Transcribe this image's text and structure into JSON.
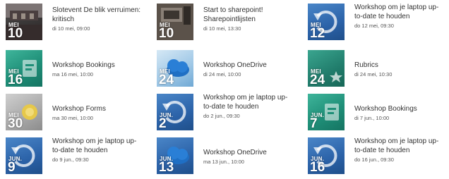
{
  "events": [
    {
      "title": "Slotevent De blik verruimen: kritisch",
      "date": "di 10 mei, 09:00",
      "month": "MEI",
      "day": "10",
      "style": "photo-dark",
      "art": "building-photo",
      "lines": "twoline"
    },
    {
      "title": "Start to sharepoint! Sharepointlijsten",
      "date": "di 10 mei, 13:30",
      "month": "MEI",
      "day": "10",
      "style": "photo-room",
      "art": "room-photo",
      "lines": "twoline"
    },
    {
      "title": "Workshop om je laptop up-to-date te houden",
      "date": "do 12 mei, 09:30",
      "month": "MEI",
      "day": "12",
      "style": "photo-blue",
      "art": "refresh-icon",
      "lines": "threeline"
    },
    {
      "title": "Workshop Bookings",
      "date": "ma 16 mei, 10:00",
      "month": "MEI",
      "day": "16",
      "style": "photo-green",
      "art": "bookings-icon",
      "lines": "oneline"
    },
    {
      "title": "Workshop OneDrive",
      "date": "di 24 mei, 10:00",
      "month": "MEI",
      "day": "24",
      "style": "photo-light",
      "art": "cloud-icon",
      "lines": "oneline"
    },
    {
      "title": "Rubrics",
      "date": "di 24 mei, 10:30",
      "month": "MEI",
      "day": "24",
      "style": "photo-teal",
      "art": "star-icon",
      "lines": "oneline"
    },
    {
      "title": "Workshop Forms",
      "date": "ma 30 mei, 10:00",
      "month": "MEI",
      "day": "30",
      "style": "photo-gray",
      "art": "forms-icon",
      "lines": "oneline"
    },
    {
      "title": "Workshop om je laptop up-to-date te houden",
      "date": "do 2 jun., 09:30",
      "month": "JUN.",
      "day": "2",
      "style": "photo-blue",
      "art": "refresh-icon",
      "lines": "threeline"
    },
    {
      "title": "Workshop Bookings",
      "date": "di 7 jun., 10:00",
      "month": "JUN.",
      "day": "7",
      "style": "photo-green",
      "art": "bookings-icon",
      "lines": "oneline"
    },
    {
      "title": "Workshop om je laptop up-to-date te houden",
      "date": "do 9 jun., 09:30",
      "month": "JUN.",
      "day": "9",
      "style": "photo-blue",
      "art": "refresh-icon",
      "lines": "threeline"
    },
    {
      "title": "Workshop OneDrive",
      "date": "ma 13 jun., 10:00",
      "month": "JUN.",
      "day": "13",
      "style": "photo-blue",
      "art": "cloud-icon",
      "lines": "oneline"
    },
    {
      "title": "Workshop om je laptop up-to-date te houden",
      "date": "do 16 jun., 09:30",
      "month": "JUN.",
      "day": "16",
      "style": "photo-blue",
      "art": "refresh-icon",
      "lines": "threeline"
    }
  ]
}
